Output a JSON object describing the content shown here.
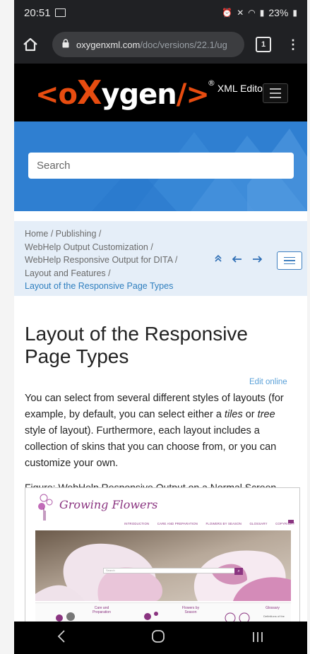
{
  "status_bar": {
    "time": "20:51",
    "battery": "23%"
  },
  "browser": {
    "url_domain": "oxygenxml.com",
    "url_path": "/doc/versions/22.1/ug",
    "tab_count": "1"
  },
  "site_header": {
    "logo_parts": [
      "<o",
      "X",
      "ygen",
      "/>"
    ],
    "logo_registered": "®",
    "product": "XML Editor"
  },
  "search": {
    "placeholder": "Search"
  },
  "breadcrumb": {
    "items": [
      "Home / Publishing /",
      "WebHelp Output Customization /",
      "WebHelp Responsive Output for DITA /",
      "Layout and Features  /"
    ],
    "current": "Layout of the Responsive Page Types"
  },
  "page": {
    "title": "Layout of the Responsive Page Types",
    "edit_online": "Edit online",
    "paragraph_parts": [
      "You can select from several different styles of layouts (for example, by default, you can select either a ",
      "tiles",
      " or ",
      "tree",
      " style of layout). Furthermore, each layout includes a collection of skins that you can choose from, or you can customize your own."
    ],
    "figure_caption": "Figure: WebHelp Responsive Output on a Normal Screen"
  },
  "figure": {
    "brand": "Growing Flowers",
    "nav": [
      "INTRODUCTION",
      "CARE AND PREPARATION",
      "FLOWERS BY SEASON",
      "GLOSSARY",
      "COPYRIGHT"
    ],
    "search_placeholder": "Search",
    "cards": [
      "Care and Preparation",
      "Flowers by Season",
      "Glossary",
      "Definitions of the"
    ]
  },
  "colors": {
    "accent_blue": "#2f7fd1",
    "logo_red": "#e74c10",
    "link_blue": "#2f7fbf",
    "brand_purple": "#8a3480"
  }
}
